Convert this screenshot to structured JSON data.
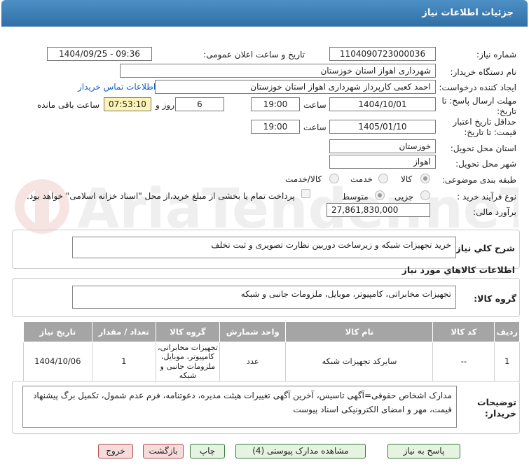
{
  "header": {
    "title": "جزئیات اطلاعات نیاز"
  },
  "form": {
    "need_number_label": "شماره نیاز:",
    "need_number": "1104090723000036",
    "announce_label": "تاریخ و ساعت اعلان عمومی:",
    "announce_value": "1404/09/25 - 09:36",
    "buyer_org_label": "نام دستگاه خریدار:",
    "buyer_org": "شهرداری اهواز استان خوزستان",
    "creator_label": "ایجاد کننده درخواست:",
    "creator": "احمد کعبی کارپرداز شهرداری اهواز استان خوزستان",
    "contact_link": "اطلاعات تماس خریدار",
    "deadline_label_1": "مهلت ارسال پاسخ: تا",
    "deadline_label_2": "تاریخ:",
    "deadline_date": "1404/10/01",
    "time_label": "ساعت",
    "deadline_time": "19:00",
    "days_value": "6",
    "days_label": "روز و",
    "remaining_time": "07:53:10",
    "remaining_label": "ساعت باقی مانده",
    "validity_label_1": "حداقل تاریخ اعتبار",
    "validity_label_2": "قیمت: تا تاریخ:",
    "validity_date": "1405/01/10",
    "validity_time": "19:00",
    "province_label": "استان محل تحویل:",
    "province": "خوزستان",
    "city_label": "شهر محل تحویل:",
    "city": "اهواز",
    "category_label": "طبقه بندی موضوعی:",
    "category_options": [
      "کالا",
      "خدمت",
      "کالا/خدمت"
    ],
    "category_selected": "کالا",
    "process_label": "نوع فرآیند خرید :",
    "process_options": [
      "جزیی",
      "متوسط"
    ],
    "process_selected": "متوسط",
    "payment_note": "پرداخت تمام یا بخشی از مبلغ خرید،از محل \"اسناد خزانه اسلامی\" خواهد بود.",
    "budget_label": "برآورد مالی:",
    "budget": "27,861,830,000"
  },
  "description": {
    "label": "شرح کلي نياز:",
    "text": "خرید تجهیزات شبکه و زیرساخت دوربین نظارت تصویری و ثبت تخلف"
  },
  "goods": {
    "section_title": "اطلاعات کالاهاي مورد نياز",
    "group_label": "گروه کالا:",
    "group_text": "تجهیزات مخابراتی، کامپیوتر، موبایل، ملزومات جانبی و شبکه",
    "table": {
      "headers": [
        "ردیف",
        "کد کالا",
        "نام کالا",
        "واحد شمارش",
        "گروه کالا",
        "تعداد / مقدار",
        "تاریخ نیاز"
      ],
      "rows": [
        [
          "1",
          "--",
          "سایرکد تجهیزات شبکه",
          "عدد",
          "تجهیزات مخابراتی، کامپیوتر، موبایل، ملزومات جانبی و شبکه",
          "1",
          "1404/10/06"
        ]
      ]
    }
  },
  "buyer_notes": {
    "label": "توضیحات خریدار:",
    "text": "مدارک اشخاص حقوقی=آگهی تاسیس، آخرین آگهی تغییرات هیئت مدیره، دعوتنامه، فرم عدم شمول، تکمیل برگ پیشنهاد قیمت، مهر و امضای الکترونیکی اسناد پیوست"
  },
  "buttons": {
    "reply": "پاسخ به نیاز",
    "attachments": "مشاهده مدارک پیوستی (4)",
    "print": "چاپ",
    "back": "بازگشت",
    "exit": "خروج"
  },
  "watermark": {
    "text": "AriaTender.neT"
  },
  "colors": {
    "header": "#3a7cb5",
    "table_header": "#a5a5a5",
    "remaining_bg": "#fdf4b6",
    "link": "#1060c0"
  }
}
